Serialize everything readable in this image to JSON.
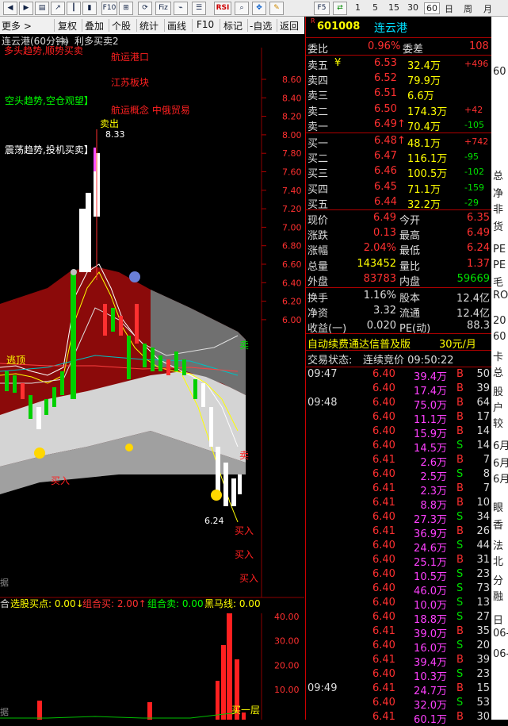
{
  "toolbar": {
    "icons": [
      "back-icon",
      "forward-icon",
      "kline-icon",
      "refresh-icon",
      "zoom-in-icon",
      "zoom-out-icon",
      "bar-icon",
      "candle-icon",
      "line-icon",
      "chart-icon",
      "f10-icon",
      "fiz-icon",
      "f10x-icon",
      "grid-icon",
      "rsi-icon",
      "zoom-icon",
      "move-icon",
      "pen-icon",
      "f5-icon",
      "swap-icon"
    ],
    "f10": "F10",
    "fiz": "Fiz",
    "rsi": "RSI",
    "f5": "F5",
    "periods": [
      "1",
      "5",
      "15",
      "30",
      "60"
    ],
    "day": "日",
    "week": "周",
    "month": "月"
  },
  "menubar": {
    "more": "更多",
    "items": [
      "复权",
      "叠加",
      "个股",
      "统计",
      "画线",
      "F10",
      "标记",
      "-自选",
      "返回"
    ]
  },
  "chart": {
    "title": "连云港(60分钟)",
    "indicator": "利多买卖2",
    "yticks": [
      "8.60",
      "8.40",
      "8.20",
      "8.00",
      "7.80",
      "7.60",
      "7.40",
      "7.20",
      "7.00",
      "6.80",
      "6.60",
      "6.40",
      "6.20",
      "6.00"
    ],
    "yvalues": [
      8.6,
      8.4,
      8.2,
      8.0,
      7.8,
      7.6,
      7.4,
      7.2,
      7.0,
      6.8,
      6.6,
      6.4,
      6.2,
      6.0
    ],
    "annotations": {
      "trend_top": "多头趋势,顺势买卖",
      "hangyun_port": "航运港口",
      "jiangsu": "江苏板块",
      "hangyun_concept": "航运概念 中俄贸易",
      "bear_trend": "空头趋势,空仓观望】",
      "shock_trend": "震荡趋势,投机买卖】",
      "sell_top": "卖出",
      "high_label": "8.33",
      "escape": "逃顶",
      "buy1": "买入",
      "sell_right": "卖",
      "sell_right2": "卖",
      "buy_right": "买入",
      "buy_right2": "买入",
      "buy_right3": "买入",
      "low_label": "6.24",
      "left_data": "据",
      "left_data2": "据"
    },
    "lower": {
      "legend_prefix": "合",
      "pick": "选股买点: 0.00↓",
      "combo_buy": "组合买: 2.00↑",
      "combo_sell": "组合卖: 0.00",
      "dark_horse": "黑马线: 0.00",
      "cut": "",
      "yticks": [
        "40.00",
        "30.00",
        "20.00",
        "10.00"
      ],
      "yvalues": [
        40,
        30,
        20,
        10
      ],
      "buy_layer": "买一层"
    }
  },
  "quote": {
    "code_badge": "R",
    "code": "601008",
    "name": "连云港",
    "weibi_label": "委比",
    "weibi": "0.96%",
    "weicha_label": "委差",
    "weicha": "108",
    "asks": [
      {
        "label": "卖五",
        "flag": "¥",
        "price": "6.53",
        "vol": "32.4万",
        "chg": "+496"
      },
      {
        "label": "卖四",
        "flag": "",
        "price": "6.52",
        "vol": "79.9万",
        "chg": ""
      },
      {
        "label": "卖三",
        "flag": "",
        "price": "6.51",
        "vol": "6.6万",
        "chg": ""
      },
      {
        "label": "卖二",
        "flag": "",
        "price": "6.50",
        "vol": "174.3万",
        "chg": "+42"
      },
      {
        "label": "卖一",
        "flag": "",
        "price": "6.49↑",
        "vol": "70.4万",
        "chg": "-105"
      }
    ],
    "bids": [
      {
        "label": "买一",
        "price": "6.48↑",
        "vol": "48.1万",
        "chg": "+742"
      },
      {
        "label": "买二",
        "price": "6.47",
        "vol": "116.1万",
        "chg": "-95"
      },
      {
        "label": "买三",
        "price": "6.46",
        "vol": "100.5万",
        "chg": "-102"
      },
      {
        "label": "买四",
        "price": "6.45",
        "vol": "71.1万",
        "chg": "-159"
      },
      {
        "label": "买五",
        "price": "6.44",
        "vol": "32.2万",
        "chg": "-29"
      }
    ],
    "stats": [
      {
        "l1": "现价",
        "v1": "6.49",
        "l2": "今开",
        "v2": "6.35"
      },
      {
        "l1": "涨跌",
        "v1": "0.13",
        "l2": "最高",
        "v2": "6.49"
      },
      {
        "l1": "涨幅",
        "v1": "2.04%",
        "l2": "最低",
        "v2": "6.24"
      },
      {
        "l1": "总量",
        "v1": "143452",
        "l2": "量比",
        "v2": "1.37"
      },
      {
        "l1": "外盘",
        "v1": "83783",
        "l2": "内盘",
        "v2": "59669"
      }
    ],
    "fund": [
      {
        "l1": "换手",
        "v1": "1.16%",
        "l2": "股本",
        "v2": "12.4亿"
      },
      {
        "l1": "净资",
        "v1": "3.32",
        "l2": "流通",
        "v2": "12.4亿"
      },
      {
        "l1": "收益(一)",
        "v1": "0.020",
        "l2": "PE(动)",
        "v2": "88.3"
      }
    ],
    "ad": "自动续费通达信普及版",
    "ad_price": "30元/月",
    "status_label": "交易状态:",
    "status": "连续竞价 09:50:22",
    "ticks": [
      {
        "t": "09:47",
        "p": "6.40",
        "v": "39.4万",
        "d": "B",
        "n": "50"
      },
      {
        "t": "",
        "p": "6.40",
        "v": "17.4万",
        "d": "B",
        "n": "39"
      },
      {
        "t": "09:48",
        "p": "6.40",
        "v": "75.0万",
        "d": "B",
        "n": "64"
      },
      {
        "t": "",
        "p": "6.40",
        "v": "11.1万",
        "d": "B",
        "n": "17"
      },
      {
        "t": "",
        "p": "6.40",
        "v": "15.9万",
        "d": "B",
        "n": "14"
      },
      {
        "t": "",
        "p": "6.40",
        "v": "14.5万",
        "d": "S",
        "n": "14"
      },
      {
        "t": "",
        "p": "6.41",
        "v": "2.6万",
        "d": "B",
        "n": "7"
      },
      {
        "t": "",
        "p": "6.40",
        "v": "2.5万",
        "d": "S",
        "n": "8"
      },
      {
        "t": "",
        "p": "6.41",
        "v": "2.3万",
        "d": "B",
        "n": "7"
      },
      {
        "t": "",
        "p": "6.41",
        "v": "8.8万",
        "d": "B",
        "n": "10"
      },
      {
        "t": "",
        "p": "6.40",
        "v": "27.3万",
        "d": "S",
        "n": "34"
      },
      {
        "t": "",
        "p": "6.41",
        "v": "36.9万",
        "d": "B",
        "n": "26"
      },
      {
        "t": "",
        "p": "6.40",
        "v": "24.6万",
        "d": "S",
        "n": "44"
      },
      {
        "t": "",
        "p": "6.40",
        "v": "25.1万",
        "d": "B",
        "n": "31"
      },
      {
        "t": "",
        "p": "6.40",
        "v": "10.5万",
        "d": "S",
        "n": "23"
      },
      {
        "t": "",
        "p": "6.40",
        "v": "46.0万",
        "d": "S",
        "n": "73"
      },
      {
        "t": "",
        "p": "6.40",
        "v": "10.0万",
        "d": "S",
        "n": "13"
      },
      {
        "t": "",
        "p": "6.40",
        "v": "18.8万",
        "d": "S",
        "n": "27"
      },
      {
        "t": "",
        "p": "6.41",
        "v": "39.0万",
        "d": "B",
        "n": "35"
      },
      {
        "t": "",
        "p": "6.40",
        "v": "16.0万",
        "d": "S",
        "n": "20"
      },
      {
        "t": "",
        "p": "6.41",
        "v": "39.4万",
        "d": "B",
        "n": "39"
      },
      {
        "t": "",
        "p": "6.40",
        "v": "10.3万",
        "d": "S",
        "n": "23"
      },
      {
        "t": "09:49",
        "p": "6.41",
        "v": "24.7万",
        "d": "B",
        "n": "15"
      },
      {
        "t": "",
        "p": "6.40",
        "v": "32.0万",
        "d": "S",
        "n": "53"
      },
      {
        "t": "",
        "p": "6.41",
        "v": "60.1万",
        "d": "B",
        "n": "30"
      }
    ]
  },
  "edge": [
    "60",
    "总",
    "净",
    "非",
    "货",
    "PE",
    "PE",
    "毛",
    "RO",
    "20",
    "60",
    "卡",
    "总",
    "股",
    "户",
    "较",
    "6月",
    "6月",
    "6月",
    "眼",
    "香",
    "法",
    "北",
    "分",
    "融",
    "日",
    "06-",
    "06-"
  ],
  "colors": {
    "up": "#ff3030",
    "down": "#00e0e0",
    "mid": "#ffffff",
    "yellow": "#ffff00",
    "panel_red": "#b00000"
  }
}
